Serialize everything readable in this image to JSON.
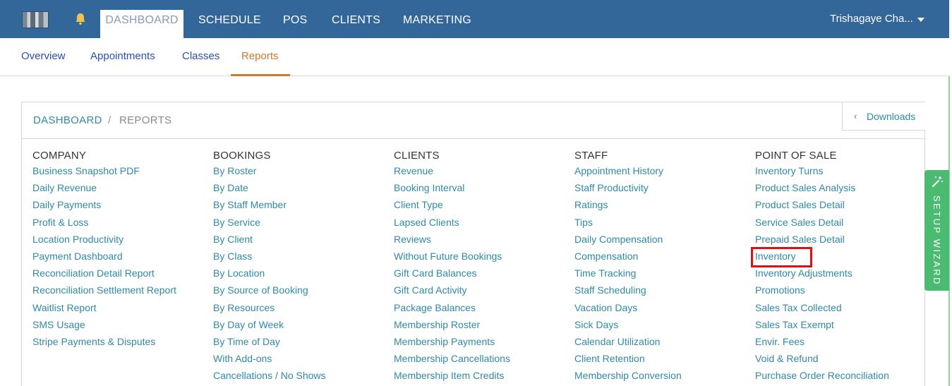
{
  "topnav": {
    "items": [
      "DASHBOARD",
      "SCHEDULE",
      "POS",
      "CLIENTS",
      "MARKETING"
    ],
    "active": "DASHBOARD",
    "user": "Trishagaye Cha..."
  },
  "subnav": {
    "items": [
      "Overview",
      "Appointments",
      "Classes",
      "Reports"
    ],
    "active": "Reports"
  },
  "breadcrumb": {
    "home": "DASHBOARD",
    "separator": "/",
    "current": "REPORTS"
  },
  "downloads": {
    "chevron": "‹",
    "label": "Downloads"
  },
  "columns": [
    {
      "title": "COMPANY",
      "links": [
        "Business Snapshot PDF",
        "Daily Revenue",
        "Daily Payments",
        "Profit & Loss",
        "Location Productivity",
        "Payment Dashboard",
        "Reconciliation Detail Report",
        "Reconciliation Settlement Report",
        "Waitlist Report",
        "SMS Usage",
        "Stripe Payments & Disputes"
      ]
    },
    {
      "title": "BOOKINGS",
      "links": [
        "By Roster",
        "By Date",
        "By Staff Member",
        "By Service",
        "By Client",
        "By Class",
        "By Location",
        "By Source of Booking",
        "By Resources",
        "By Day of Week",
        "By Time of Day",
        "With Add-ons",
        "Cancellations / No Shows"
      ]
    },
    {
      "title": "CLIENTS",
      "links": [
        "Revenue",
        "Booking Interval",
        "Client Type",
        "Lapsed Clients",
        "Reviews",
        "Without Future Bookings",
        "Gift Card Balances",
        "Gift Card Activity",
        "Package Balances",
        "Membership Roster",
        "Membership Payments",
        "Membership Cancellations",
        "Membership Item Credits"
      ]
    },
    {
      "title": "STAFF",
      "links": [
        "Appointment History",
        "Staff Productivity",
        "Ratings",
        "Tips",
        "Daily Compensation",
        "Compensation",
        "Time Tracking",
        "Staff Scheduling",
        "Vacation Days",
        "Sick Days",
        "Calendar Utilization",
        "Client Retention",
        "Membership Conversion"
      ]
    },
    {
      "title": "POINT OF SALE",
      "links": [
        "Inventory Turns",
        "Product Sales Analysis",
        "Product Sales Detail",
        "Service Sales Detail",
        "Prepaid Sales Detail",
        "Inventory",
        "Inventory Adjustments",
        "Promotions",
        "Sales Tax Collected",
        "Sales Tax Exempt",
        "Envir. Fees",
        "Void & Refund",
        "Purchase Order Reconciliation"
      ]
    }
  ],
  "wizard": {
    "label": "SETUP WIZARD",
    "icon": "magic-wand-icon"
  },
  "colors": {
    "topbar": "#336699",
    "link": "#2f8aa6",
    "active_tab": "#cf7a2b",
    "wizard": "#4cbb72",
    "highlight": "#e01010"
  }
}
